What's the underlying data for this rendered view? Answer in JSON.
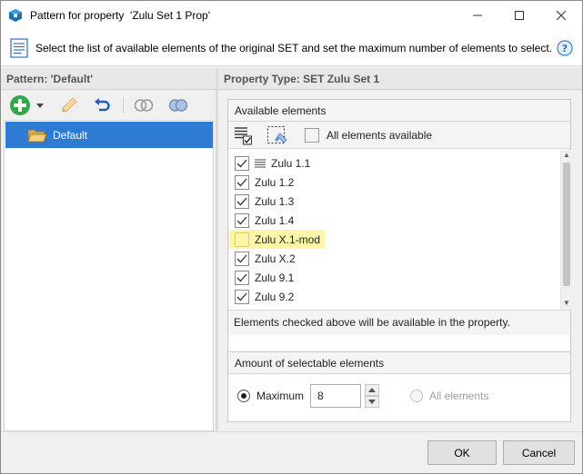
{
  "window": {
    "title": "Pattern for property  'Zulu Set 1 Prop'"
  },
  "instructions": {
    "text": "Select the list of available elements of the original SET and set the maximum number of elements to select."
  },
  "left_pane": {
    "header": "Pattern: 'Default'",
    "toolbar": {
      "icons": [
        "add-icon",
        "dropdown-arrow-icon",
        "edit-icon",
        "undo-icon",
        "link-rings-icon",
        "link-rings-filled-icon"
      ]
    },
    "tree": {
      "items": [
        {
          "label": "Default",
          "selected": true
        }
      ]
    }
  },
  "right_pane": {
    "header": "Property Type: SET Zulu Set 1",
    "available": {
      "title": "Available elements",
      "all_available_label": "All elements available",
      "items": [
        {
          "label": "Zulu 1.1",
          "checked": true,
          "has_list_icon": true
        },
        {
          "label": "Zulu 1.2",
          "checked": true
        },
        {
          "label": "Zulu 1.3",
          "checked": true
        },
        {
          "label": "Zulu 1.4",
          "checked": true
        },
        {
          "label": "Zulu X.1-mod",
          "checked": false,
          "highlighted": true
        },
        {
          "label": "Zulu X.2",
          "checked": true
        },
        {
          "label": "Zulu 9.1",
          "checked": true
        },
        {
          "label": "Zulu 9.2",
          "checked": true
        }
      ],
      "footer": "Elements checked above will be available in the property."
    },
    "amount": {
      "title": "Amount of selectable elements",
      "maximum_label": "Maximum",
      "maximum_value": "8",
      "all_elements_label": "All elements"
    }
  },
  "buttons": {
    "ok": "OK",
    "cancel": "Cancel"
  },
  "colors": {
    "selection": "#2e7bd4",
    "highlight": "#fcf7a8",
    "accent_green": "#2fa84f"
  }
}
